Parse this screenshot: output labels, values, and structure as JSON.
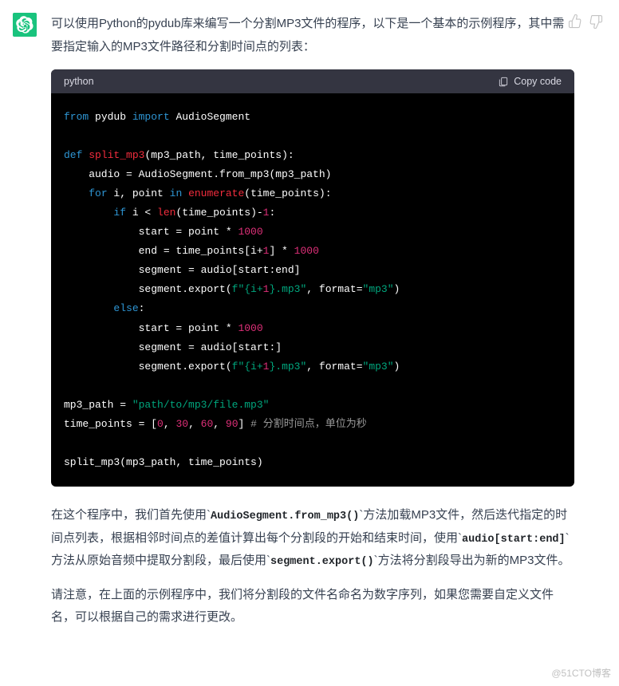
{
  "intro": "可以使用Python的pydub库来编写一个分割MP3文件的程序，以下是一个基本的示例程序，其中需要指定输入的MP3文件路径和分割时间点的列表：",
  "code_lang": "python",
  "copy_label": "Copy code",
  "code": {
    "l1_from": "from",
    "l1_pydub": " pydub ",
    "l1_import": "import",
    "l1_as": " AudioSegment",
    "l3_def": "def",
    "l3_fn": "split_mp3",
    "l3_args": "(mp3_path, time_points):",
    "l4": "    audio = AudioSegment.from_mp3(mp3_path)",
    "l5_for": "for",
    "l5_mid": " i, point ",
    "l5_in": "in",
    "l5_enum": "enumerate",
    "l5_tail": "(time_points):",
    "l6_if": "if",
    "l6_body": " i < ",
    "l6_len": "len",
    "l6_tail": "(time_points)-",
    "l6_one": "1",
    "l6_colon": ":",
    "l7_a": "            start = point * ",
    "l7_n": "1000",
    "l8_a": "            end = time_points[i+",
    "l8_one": "1",
    "l8_b": "] * ",
    "l8_n": "1000",
    "l9": "            segment = audio[start:end]",
    "l10_a": "            segment.export(",
    "l10_f": "f\"",
    "l10_brace": "{i+",
    "l10_one": "1",
    "l10_close": "}",
    "l10_ext": ".mp3\"",
    "l10_b": ", format=",
    "l10_fmt": "\"mp3\"",
    "l10_c": ")",
    "l11_else": "else",
    "l11_colon": ":",
    "l12_a": "            start = point * ",
    "l12_n": "1000",
    "l13": "            segment = audio[start:]",
    "l14_a": "            segment.export(",
    "l14_f": "f\"",
    "l14_brace": "{i+",
    "l14_one": "1",
    "l14_close": "}",
    "l14_ext": ".mp3\"",
    "l14_b": ", format=",
    "l14_fmt": "\"mp3\"",
    "l14_c": ")",
    "l16_a": "mp3_path = ",
    "l16_s": "\"path/to/mp3/file.mp3\"",
    "l17_a": "time_points = [",
    "l17_n1": "0",
    "l17_c1": ", ",
    "l17_n2": "30",
    "l17_c2": ", ",
    "l17_n3": "60",
    "l17_c3": ", ",
    "l17_n4": "90",
    "l17_b": "] ",
    "l17_cm": "# 分割时间点，单位为秒",
    "l19": "split_mp3(mp3_path, time_points)"
  },
  "para2_a": "在这个程序中，我们首先使用`",
  "para2_c1": "AudioSegment.from_mp3()",
  "para2_b": "`方法加载MP3文件，然后迭代指定的时间点列表，根据相邻时间点的差值计算出每个分割段的开始和结束时间，使用`",
  "para2_c2": "audio[start:end]",
  "para2_c": "`方法从原始音频中提取分割段，最后使用`",
  "para2_c3": "segment.export()",
  "para2_d": "`方法将分割段导出为新的MP3文件。",
  "para3": "请注意，在上面的示例程序中，我们将分割段的文件名命名为数字序列，如果您需要自定义文件名，可以根据自己的需求进行更改。",
  "watermark": "@51CTO博客"
}
